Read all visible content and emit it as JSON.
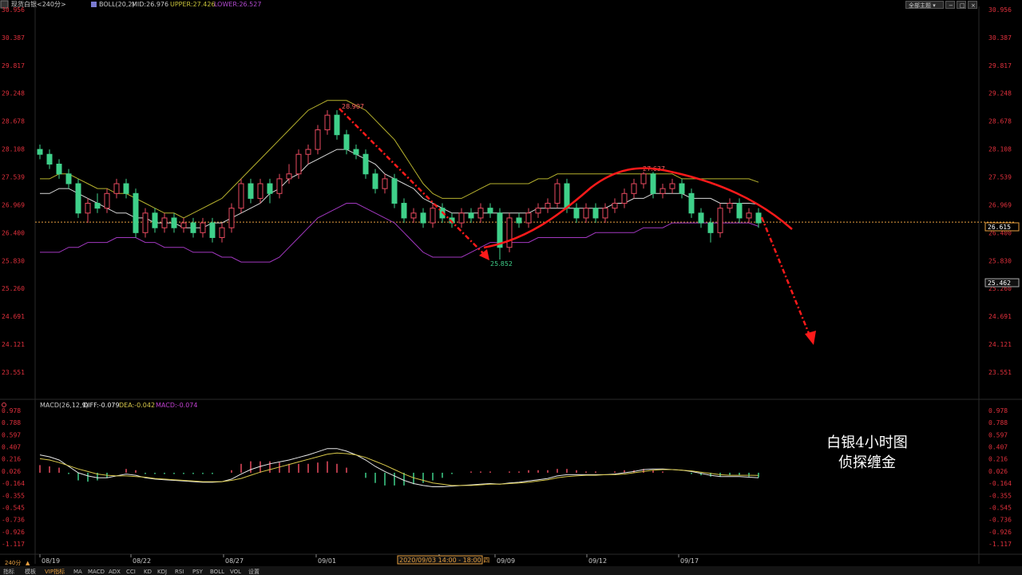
{
  "header": {
    "symbol": "现货白银<240分>",
    "boll_label": "BOLL(20,2)",
    "mid": "MID:26.976",
    "upper": "UPPER:27.426",
    "lower": "LOWER:26.527",
    "theme_button": "全部主题"
  },
  "macd_header": {
    "label": "MACD(26,12,9)",
    "diff": "DIFF:-0.079",
    "dea": "DEA:-0.042",
    "macd": "MACD:-0.074"
  },
  "price_axis_ticks": [
    "30.956",
    "30.387",
    "29.817",
    "29.248",
    "28.678",
    "28.108",
    "27.539",
    "26.969",
    "26.400",
    "25.830",
    "25.260",
    "24.691",
    "24.121",
    "23.551"
  ],
  "macd_axis_ticks": [
    "0.978",
    "0.788",
    "0.597",
    "0.407",
    "0.216",
    "0.026",
    "-0.164",
    "-0.355",
    "-0.545",
    "-0.736",
    "-0.926",
    "-1.117"
  ],
  "current_price": "26.615",
  "cursor_price": "25.462",
  "dates": [
    "08/19",
    "08/22",
    "08/27",
    "09/01",
    "09/09",
    "09/12",
    "09/17"
  ],
  "crosshair_time": "2020/09/03 14:00 - 18:00 四",
  "annotations": {
    "high": "28.907",
    "low": "25.852",
    "mid_high": "27.637"
  },
  "caption": {
    "line1": "白银4小时图",
    "line2": "侦探缠金"
  },
  "bottom_tabs": [
    "指标",
    "模板",
    "VIP指标",
    "MA",
    "MACD",
    "ADX",
    "CCI",
    "KD",
    "KDJ",
    "RSI",
    "PSY",
    "BOLL",
    "VOL",
    "设置"
  ],
  "bottom_period": "240分",
  "colors": {
    "up": "#e84a5f",
    "down": "#3fd08a",
    "upper": "#b7b22e",
    "lower": "#a238c0",
    "mid": "#d8d8d8",
    "arrow": "#ff1a1a",
    "dea": "#d8c84a",
    "diff": "#e8e8e8"
  },
  "chart_data": {
    "type": "candlestick",
    "series": [
      {
        "name": "price",
        "values": [
          [
            28.1,
            28.0,
            28.2,
            27.9
          ],
          [
            28.0,
            27.8,
            28.1,
            27.7
          ],
          [
            27.8,
            27.6,
            27.9,
            27.5
          ],
          [
            27.6,
            27.4,
            27.7,
            27.3
          ],
          [
            27.4,
            26.8,
            27.5,
            26.7
          ],
          [
            26.8,
            27.0,
            27.1,
            26.6
          ],
          [
            27.0,
            26.9,
            27.2,
            26.8
          ],
          [
            26.9,
            27.2,
            27.3,
            26.8
          ],
          [
            27.2,
            27.4,
            27.5,
            27.1
          ],
          [
            27.4,
            27.2,
            27.5,
            27.1
          ],
          [
            27.2,
            26.4,
            27.3,
            26.3
          ],
          [
            26.4,
            26.8,
            26.9,
            26.3
          ],
          [
            26.8,
            26.5,
            26.9,
            26.4
          ],
          [
            26.5,
            26.7,
            26.8,
            26.4
          ],
          [
            26.7,
            26.5,
            26.8,
            26.4
          ],
          [
            26.5,
            26.6,
            26.7,
            26.4
          ],
          [
            26.6,
            26.4,
            26.7,
            26.3
          ],
          [
            26.4,
            26.6,
            26.7,
            26.3
          ],
          [
            26.6,
            26.3,
            26.7,
            26.2
          ],
          [
            26.3,
            26.5,
            26.6,
            26.2
          ],
          [
            26.5,
            26.9,
            27.0,
            26.4
          ],
          [
            26.9,
            27.4,
            27.5,
            26.8
          ],
          [
            27.4,
            27.1,
            27.5,
            27.0
          ],
          [
            27.1,
            27.4,
            27.5,
            27.0
          ],
          [
            27.4,
            27.2,
            27.5,
            27.0
          ],
          [
            27.2,
            27.5,
            27.6,
            27.1
          ],
          [
            27.5,
            27.6,
            27.8,
            27.4
          ],
          [
            27.6,
            28.0,
            28.1,
            27.5
          ],
          [
            28.0,
            28.1,
            28.2,
            27.8
          ],
          [
            28.1,
            28.5,
            28.6,
            28.0
          ],
          [
            28.5,
            28.8,
            28.9,
            28.4
          ],
          [
            28.8,
            28.4,
            28.9,
            28.3
          ],
          [
            28.4,
            28.1,
            28.5,
            28.0
          ],
          [
            28.1,
            28.0,
            28.2,
            27.9
          ],
          [
            28.0,
            27.6,
            28.1,
            27.5
          ],
          [
            27.6,
            27.3,
            27.7,
            27.2
          ],
          [
            27.3,
            27.5,
            27.6,
            27.2
          ],
          [
            27.5,
            27.0,
            27.6,
            26.9
          ],
          [
            27.0,
            26.7,
            27.1,
            26.6
          ],
          [
            26.7,
            26.8,
            26.9,
            26.6
          ],
          [
            26.8,
            26.6,
            26.9,
            26.5
          ],
          [
            26.6,
            26.9,
            27.0,
            26.5
          ],
          [
            26.9,
            26.7,
            27.0,
            26.6
          ],
          [
            26.7,
            26.6,
            26.8,
            26.5
          ],
          [
            26.6,
            26.8,
            26.9,
            26.5
          ],
          [
            26.8,
            26.7,
            26.9,
            26.6
          ],
          [
            26.7,
            26.9,
            27.0,
            26.6
          ],
          [
            26.9,
            26.8,
            27.0,
            26.7
          ],
          [
            26.8,
            26.1,
            26.9,
            25.85
          ],
          [
            26.1,
            26.7,
            26.8,
            26.0
          ],
          [
            26.7,
            26.6,
            26.8,
            26.5
          ],
          [
            26.6,
            26.8,
            26.9,
            26.5
          ],
          [
            26.8,
            26.9,
            27.0,
            26.7
          ],
          [
            26.9,
            27.0,
            27.1,
            26.8
          ],
          [
            27.0,
            27.4,
            27.5,
            26.9
          ],
          [
            27.4,
            26.9,
            27.5,
            26.8
          ],
          [
            26.9,
            26.7,
            27.0,
            26.6
          ],
          [
            26.7,
            26.9,
            27.0,
            26.6
          ],
          [
            26.9,
            26.7,
            27.0,
            26.6
          ],
          [
            26.7,
            26.9,
            27.0,
            26.6
          ],
          [
            26.9,
            27.0,
            27.1,
            26.8
          ],
          [
            27.0,
            27.2,
            27.3,
            26.9
          ],
          [
            27.2,
            27.4,
            27.5,
            27.1
          ],
          [
            27.4,
            27.6,
            27.64,
            27.3
          ],
          [
            27.6,
            27.2,
            27.64,
            27.1
          ],
          [
            27.2,
            27.3,
            27.4,
            27.1
          ],
          [
            27.3,
            27.4,
            27.5,
            27.2
          ],
          [
            27.4,
            27.2,
            27.5,
            27.1
          ],
          [
            27.2,
            26.8,
            27.3,
            26.7
          ],
          [
            26.8,
            26.6,
            26.9,
            26.5
          ],
          [
            26.6,
            26.4,
            26.7,
            26.2
          ],
          [
            26.4,
            26.9,
            27.0,
            26.3
          ],
          [
            26.9,
            27.0,
            27.1,
            26.8
          ],
          [
            27.0,
            26.7,
            27.1,
            26.6
          ],
          [
            26.7,
            26.8,
            26.9,
            26.6
          ],
          [
            26.8,
            26.6,
            26.9,
            26.5
          ]
        ]
      },
      {
        "name": "UPPER",
        "values": [
          27.5,
          27.5,
          27.6,
          27.6,
          27.5,
          27.4,
          27.3,
          27.3,
          27.2,
          27.2,
          27.1,
          27.0,
          26.9,
          26.8,
          26.8,
          26.7,
          26.8,
          26.9,
          27.0,
          27.1,
          27.3,
          27.5,
          27.7,
          27.9,
          28.1,
          28.3,
          28.5,
          28.7,
          28.9,
          29.0,
          29.1,
          29.1,
          29.1,
          29.0,
          28.9,
          28.7,
          28.5,
          28.3,
          28.0,
          27.7,
          27.4,
          27.2,
          27.1,
          27.1,
          27.1,
          27.2,
          27.3,
          27.4,
          27.4,
          27.4,
          27.4,
          27.4,
          27.5,
          27.5,
          27.6,
          27.6,
          27.6,
          27.6,
          27.6,
          27.6,
          27.6,
          27.6,
          27.6,
          27.6,
          27.6,
          27.6,
          27.6,
          27.5,
          27.5,
          27.5,
          27.5,
          27.5,
          27.5,
          27.5,
          27.5,
          27.43
        ]
      },
      {
        "name": "MID",
        "values": [
          27.2,
          27.2,
          27.3,
          27.3,
          27.2,
          27.1,
          27.0,
          26.9,
          26.8,
          26.8,
          26.7,
          26.7,
          26.6,
          26.6,
          26.6,
          26.5,
          26.5,
          26.5,
          26.6,
          26.6,
          26.7,
          26.8,
          26.9,
          27.0,
          27.2,
          27.3,
          27.5,
          27.6,
          27.8,
          27.9,
          28.0,
          28.1,
          28.1,
          28.0,
          27.9,
          27.8,
          27.6,
          27.5,
          27.4,
          27.3,
          27.1,
          27.0,
          26.9,
          26.8,
          26.8,
          26.8,
          26.8,
          26.8,
          26.8,
          26.8,
          26.8,
          26.8,
          26.9,
          26.9,
          26.9,
          26.9,
          26.9,
          26.9,
          26.9,
          26.9,
          27.0,
          27.0,
          27.1,
          27.1,
          27.2,
          27.2,
          27.2,
          27.2,
          27.1,
          27.1,
          27.1,
          27.0,
          27.0,
          27.0,
          27.0,
          26.98
        ]
      },
      {
        "name": "LOWER",
        "values": [
          26.0,
          26.0,
          26.0,
          26.1,
          26.1,
          26.2,
          26.2,
          26.2,
          26.3,
          26.3,
          26.3,
          26.2,
          26.2,
          26.1,
          26.1,
          26.1,
          26.0,
          26.0,
          26.0,
          25.9,
          25.9,
          25.8,
          25.8,
          25.8,
          25.8,
          25.9,
          26.1,
          26.3,
          26.5,
          26.7,
          26.8,
          26.9,
          27.0,
          27.0,
          26.9,
          26.8,
          26.7,
          26.6,
          26.4,
          26.2,
          26.0,
          25.9,
          25.9,
          25.9,
          25.9,
          26.0,
          26.1,
          26.2,
          26.2,
          26.2,
          26.2,
          26.2,
          26.3,
          26.3,
          26.3,
          26.3,
          26.3,
          26.3,
          26.4,
          26.4,
          26.4,
          26.4,
          26.4,
          26.5,
          26.5,
          26.5,
          26.6,
          26.6,
          26.6,
          26.6,
          26.6,
          26.6,
          26.6,
          26.6,
          26.6,
          26.53
        ]
      },
      {
        "name": "DIFF",
        "values": [
          0.28,
          0.25,
          0.2,
          0.1,
          0.0,
          -0.05,
          -0.08,
          -0.08,
          -0.05,
          -0.02,
          -0.04,
          -0.08,
          -0.1,
          -0.11,
          -0.12,
          -0.13,
          -0.14,
          -0.15,
          -0.15,
          -0.14,
          -0.1,
          -0.02,
          0.05,
          0.1,
          0.14,
          0.17,
          0.2,
          0.24,
          0.28,
          0.33,
          0.38,
          0.38,
          0.34,
          0.28,
          0.2,
          0.1,
          0.02,
          -0.05,
          -0.12,
          -0.17,
          -0.2,
          -0.22,
          -0.22,
          -0.21,
          -0.2,
          -0.19,
          -0.18,
          -0.17,
          -0.18,
          -0.16,
          -0.15,
          -0.13,
          -0.11,
          -0.09,
          -0.05,
          -0.03,
          -0.03,
          -0.03,
          -0.03,
          -0.03,
          -0.02,
          0.0,
          0.02,
          0.05,
          0.06,
          0.06,
          0.05,
          0.04,
          0.02,
          -0.01,
          -0.04,
          -0.06,
          -0.06,
          -0.06,
          -0.07,
          -0.079
        ]
      },
      {
        "name": "DEA",
        "values": [
          0.22,
          0.2,
          0.16,
          0.11,
          0.06,
          0.02,
          -0.02,
          -0.04,
          -0.05,
          -0.05,
          -0.06,
          -0.07,
          -0.09,
          -0.1,
          -0.11,
          -0.12,
          -0.13,
          -0.14,
          -0.14,
          -0.14,
          -0.12,
          -0.09,
          -0.04,
          0.01,
          0.05,
          0.09,
          0.13,
          0.17,
          0.21,
          0.25,
          0.29,
          0.31,
          0.3,
          0.28,
          0.24,
          0.18,
          0.12,
          0.05,
          -0.02,
          -0.08,
          -0.12,
          -0.16,
          -0.18,
          -0.2,
          -0.2,
          -0.2,
          -0.19,
          -0.18,
          -0.18,
          -0.17,
          -0.16,
          -0.15,
          -0.13,
          -0.11,
          -0.08,
          -0.06,
          -0.05,
          -0.04,
          -0.04,
          -0.03,
          -0.03,
          -0.02,
          0.0,
          0.02,
          0.04,
          0.05,
          0.05,
          0.04,
          0.03,
          0.01,
          -0.01,
          -0.03,
          -0.04,
          -0.04,
          -0.04,
          -0.042
        ]
      }
    ],
    "ylim": [
      23.551,
      30.956
    ],
    "macd_ylim": [
      -1.117,
      0.978
    ],
    "grid": false
  }
}
